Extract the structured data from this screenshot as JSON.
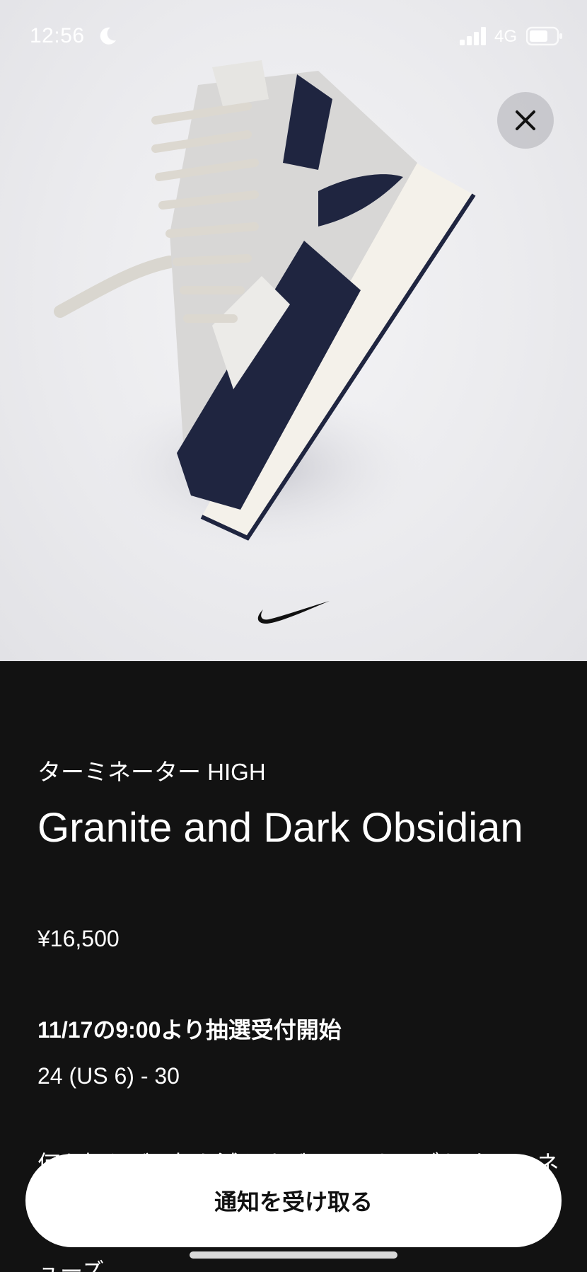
{
  "status_bar": {
    "time": "12:56",
    "network": "4G",
    "icons": [
      "moon-icon",
      "signal-icon",
      "battery-icon"
    ]
  },
  "hero": {
    "close_icon": "close-icon",
    "image": "high-top-sneaker-image",
    "logo": "swoosh-logo"
  },
  "product": {
    "subtitle": "ターミネーター HIGH",
    "title": "Granite and Dark Obsidian",
    "price": "¥16,500",
    "launch_info": "11/17の9:00より抽選受付開始",
    "size_range": "24 (US 6) - 30",
    "description": "何も加えず、何も減らさず。アーカイブか ターミネーター HIGHは、クラシックなバスケットボールシューズ"
  },
  "actions": {
    "notify_label": "通知を受け取る"
  },
  "colors": {
    "background": "#121212",
    "navy": "#1f2540",
    "button": "#ffffff"
  }
}
